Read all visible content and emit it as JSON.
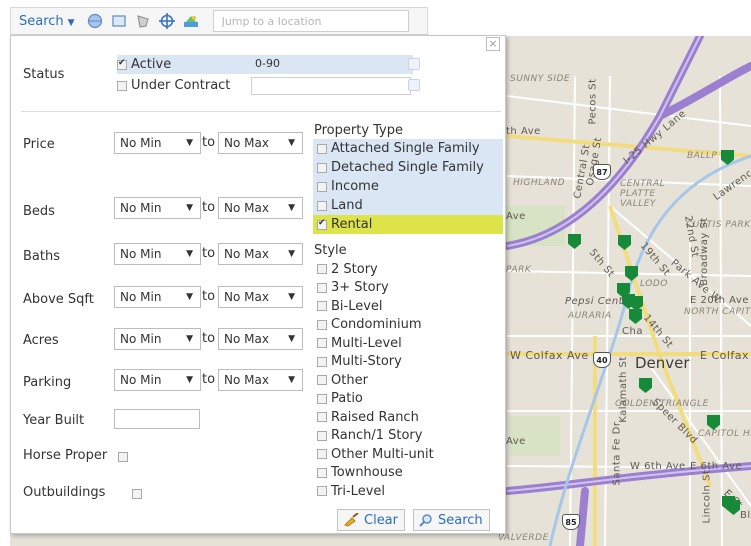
{
  "toolbar": {
    "search_label": "Search",
    "jump_placeholder": "Jump to a location",
    "icons": [
      "circle-draw-icon",
      "rectangle-draw-icon",
      "polygon-draw-icon",
      "target-icon",
      "layers-icon"
    ]
  },
  "map": {
    "labels": {
      "sunny_side": "SUNNY SIDE",
      "highland": "HIGHLAND",
      "ballpark": "BALLP",
      "lawrence": "Lawrence",
      "i25": "I-25 Hwy Lane",
      "central_platte": "CENTRAL PLATTE VALLEY",
      "curtis_park": "CURTIS PARK",
      "lodo": "LODO",
      "pepsi_center": "Pepsi Center",
      "auraria": "AURARIA",
      "north_capitol": "NORTH CAPITO",
      "e20th": "E 20th Ave",
      "park_ave": "Park Ave W",
      "broadway": "Broadway St",
      "w_colfax": "W Colfax Ave",
      "e_colfax": "E Colfax A",
      "denver": "Denver",
      "golden_triangle": "GOLDEN TRIANGLE",
      "capitol_hill": "CAPITOL HI",
      "w6th": "W 6th Ave",
      "e6th": "E 6th Ave",
      "santa_fe": "Santa Fe Dr",
      "kalamath": "Kalamath St",
      "speer": "Speer Blvd",
      "lincoln": "Lincoln St",
      "pecos": "Pecos St",
      "central": "Central St",
      "osage": "Osage St",
      "ave1": "th Ave",
      "ave2": "Ave",
      "ave3": "Ave",
      "park": "PARK",
      "valverde": "VALVERDE",
      "st5": "5th St",
      "st19": "19th St",
      "st22": "22nd St",
      "st14": "14th St",
      "cha": "Cha",
      "e_st": "E St",
      "bl": "Bl"
    },
    "shields": {
      "i87": "87",
      "i40": "40",
      "i85": "85"
    }
  },
  "panel": {
    "close_glyph": "×",
    "status": {
      "label": "Status",
      "options": [
        {
          "name": "Active",
          "checked": true,
          "value": "0-90"
        },
        {
          "name": "Under Contract",
          "checked": false,
          "value": ""
        }
      ]
    },
    "ranges": [
      {
        "key": "price",
        "label": "Price",
        "min": "No Min",
        "max": "No Max"
      },
      {
        "key": "beds",
        "label": "Beds",
        "min": "No Min",
        "max": "No Max"
      },
      {
        "key": "baths",
        "label": "Baths",
        "min": "No Min",
        "max": "No Max"
      },
      {
        "key": "sqft",
        "label": "Above Sqft",
        "min": "No Min",
        "max": "No Max"
      },
      {
        "key": "acres",
        "label": "Acres",
        "min": "No Min",
        "max": "No Max"
      },
      {
        "key": "parking",
        "label": "Parking",
        "min": "No Min",
        "max": "No Max"
      }
    ],
    "to_label": "to",
    "caret": "▼",
    "year_built_label": "Year Built",
    "horse_label": "Horse Proper",
    "outbuildings_label": "Outbuildings",
    "property_type": {
      "label": "Property Type",
      "items": [
        {
          "name": "Attached Single Family",
          "checked": false
        },
        {
          "name": "Detached Single Family",
          "checked": false
        },
        {
          "name": "Income",
          "checked": false
        },
        {
          "name": "Land",
          "checked": false
        },
        {
          "name": "Rental",
          "checked": true
        }
      ]
    },
    "style": {
      "label": "Style",
      "items": [
        "2 Story",
        "3+ Story",
        "Bi-Level",
        "Condominium",
        "Multi-Level",
        "Multi-Story",
        "Other",
        "Patio",
        "Raised Ranch",
        "Ranch/1 Story",
        "Other Multi-unit",
        "Townhouse",
        "Tri-Level"
      ]
    },
    "buttons": {
      "clear": "Clear",
      "search": "Search"
    }
  },
  "colors": {
    "accent_blue": "#2a6fb8",
    "selection_blue": "#dbe6f5",
    "highlight_yellow": "#dce44a",
    "pin_green": "#178a3a",
    "highway_purple": "#9b7fd0"
  }
}
